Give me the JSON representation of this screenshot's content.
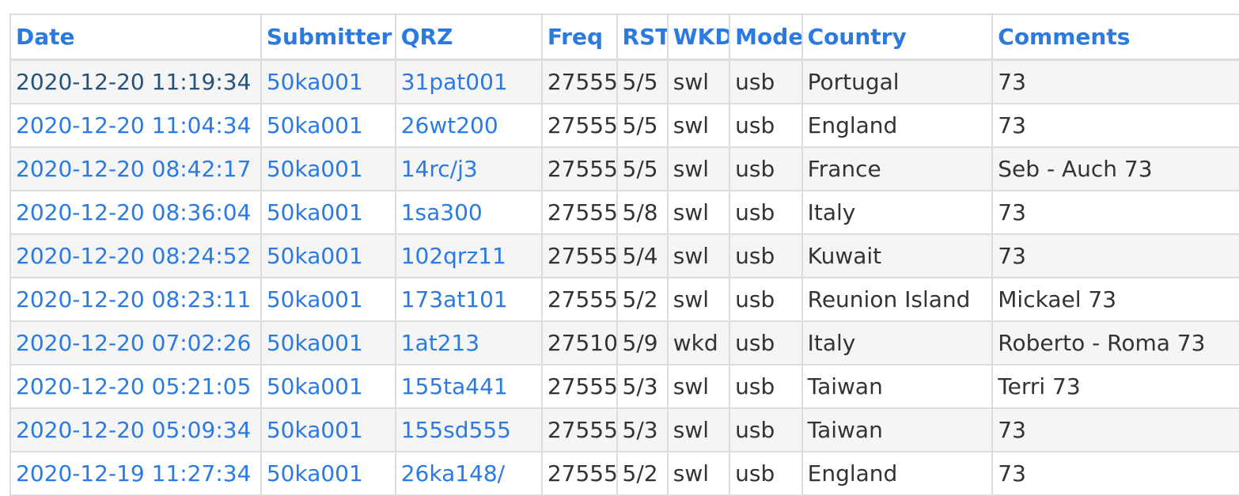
{
  "colors": {
    "link": "#2a7ae2",
    "link_visited": "#23527c",
    "text": "#333333",
    "border": "#dddddd",
    "stripe": "#f5f5f5"
  },
  "table": {
    "headers": [
      "Date",
      "Submitter",
      "QRZ",
      "Freq",
      "RST",
      "WKD",
      "Mode",
      "Country",
      "Comments"
    ],
    "rows": [
      {
        "date": "2020-12-20 11:19:34",
        "submitter": "50ka001",
        "qrz": "31pat001",
        "freq": "27555",
        "rst": "5/5",
        "wkd": "swl",
        "mode": "usb",
        "country": "Portugal",
        "comments": "73"
      },
      {
        "date": "2020-12-20 11:04:34",
        "submitter": "50ka001",
        "qrz": "26wt200",
        "freq": "27555",
        "rst": "5/5",
        "wkd": "swl",
        "mode": "usb",
        "country": "England",
        "comments": "73"
      },
      {
        "date": "2020-12-20 08:42:17",
        "submitter": "50ka001",
        "qrz": "14rc/j3",
        "freq": "27555",
        "rst": "5/5",
        "wkd": "swl",
        "mode": "usb",
        "country": "France",
        "comments": "Seb - Auch 73"
      },
      {
        "date": "2020-12-20 08:36:04",
        "submitter": "50ka001",
        "qrz": "1sa300",
        "freq": "27555",
        "rst": "5/8",
        "wkd": "swl",
        "mode": "usb",
        "country": "Italy",
        "comments": "73"
      },
      {
        "date": "2020-12-20 08:24:52",
        "submitter": "50ka001",
        "qrz": "102qrz11",
        "freq": "27555",
        "rst": "5/4",
        "wkd": "swl",
        "mode": "usb",
        "country": "Kuwait",
        "comments": "73"
      },
      {
        "date": "2020-12-20 08:23:11",
        "submitter": "50ka001",
        "qrz": "173at101",
        "freq": "27555",
        "rst": "5/2",
        "wkd": "swl",
        "mode": "usb",
        "country": "Reunion Island",
        "comments": "Mickael 73"
      },
      {
        "date": "2020-12-20 07:02:26",
        "submitter": "50ka001",
        "qrz": "1at213",
        "freq": "27510",
        "rst": "5/9",
        "wkd": "wkd",
        "mode": "usb",
        "country": "Italy",
        "comments": "Roberto - Roma 73"
      },
      {
        "date": "2020-12-20 05:21:05",
        "submitter": "50ka001",
        "qrz": "155ta441",
        "freq": "27555",
        "rst": "5/3",
        "wkd": "swl",
        "mode": "usb",
        "country": "Taiwan",
        "comments": "Terri 73"
      },
      {
        "date": "2020-12-20 05:09:34",
        "submitter": "50ka001",
        "qrz": "155sd555",
        "freq": "27555",
        "rst": "5/3",
        "wkd": "swl",
        "mode": "usb",
        "country": "Taiwan",
        "comments": "73"
      },
      {
        "date": "2020-12-19 11:27:34",
        "submitter": "50ka001",
        "qrz": "26ka148/",
        "freq": "27555",
        "rst": "5/2",
        "wkd": "swl",
        "mode": "usb",
        "country": "England",
        "comments": "73"
      }
    ]
  }
}
